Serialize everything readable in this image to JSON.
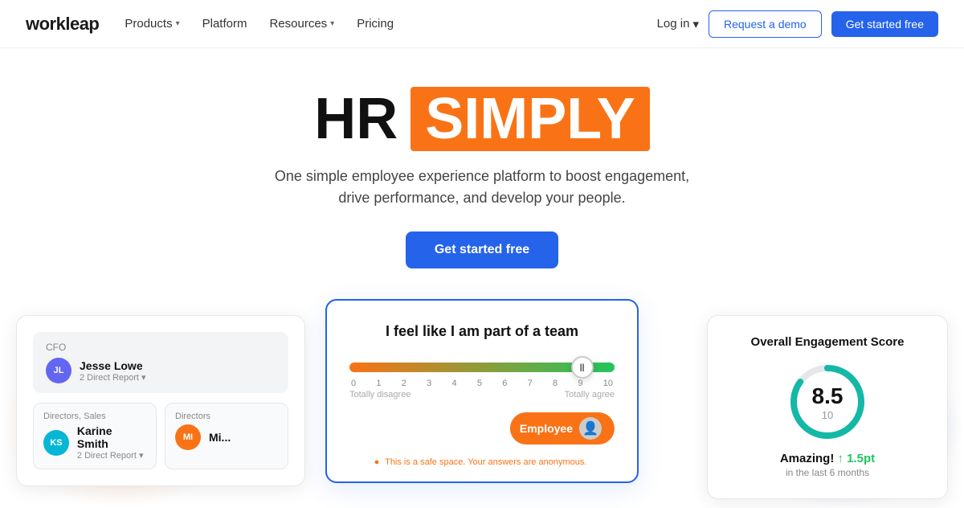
{
  "brand": {
    "name": "workleap",
    "logo_text": "workleap"
  },
  "nav": {
    "links": [
      {
        "label": "Products",
        "has_caret": true
      },
      {
        "label": "Platform",
        "has_caret": false
      },
      {
        "label": "Resources",
        "has_caret": true
      },
      {
        "label": "Pricing",
        "has_caret": false
      }
    ],
    "login_label": "Log in",
    "demo_label": "Request a demo",
    "started_label": "Get started free"
  },
  "hero": {
    "title_plain": "HR",
    "title_highlight": "SIMPLY",
    "subtitle": "One simple employee experience platform to boost engagement, drive performance, and develop your people.",
    "cta_label": "Get started free"
  },
  "card_org": {
    "cfo_label": "CFO",
    "person1_initials": "JL",
    "person1_name": "Jesse Lowe",
    "person1_reports": "2 Direct Report",
    "person2_title": "Directors, Sales",
    "person2_initials": "KS",
    "person2_name": "Karine Smith",
    "person2_reports": "2 Direct Report",
    "person3_title": "Directors",
    "person3_initials": "MI",
    "person3_name": "Mi..."
  },
  "card_survey": {
    "question": "I feel like I am part of a team",
    "scale_min": "0",
    "scale_max": "10",
    "numbers": [
      "0",
      "1",
      "2",
      "3",
      "4",
      "5",
      "6",
      "7",
      "8",
      "9",
      "10"
    ],
    "label_left": "Totally disagree",
    "label_right": "Totally agree",
    "thumb_value": "||",
    "employee_label": "Employee",
    "footer_text": "This is a safe space. Your answers are anonymous."
  },
  "card_engagement": {
    "title": "Overall Engagement Score",
    "score": "8.5",
    "total": "10",
    "amazing_label": "Amazing!",
    "change": "↑ 1.5pt",
    "period": "in the last 6 months",
    "circle_pct": 85
  }
}
